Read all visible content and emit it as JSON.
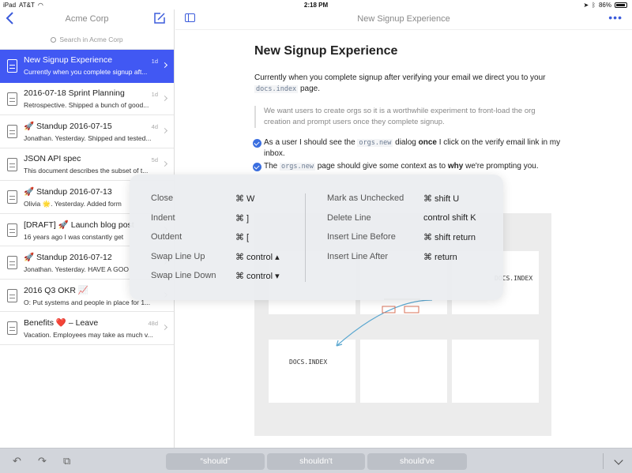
{
  "status": {
    "carrier": "AT&T",
    "ipad": "iPad",
    "time": "2:18 PM",
    "battery": "86%",
    "battery_level": 0.86
  },
  "sidebar": {
    "title": "Acme Corp",
    "search_placeholder": "Search in Acme Corp",
    "items": [
      {
        "title": "New Signup Experience",
        "sub": "Currently when you complete signup aft...",
        "age": "1d",
        "active": true
      },
      {
        "title": "2016-07-18 Sprint Planning",
        "sub": "Retrospective. Shipped a bunch of good...",
        "age": "1d"
      },
      {
        "title": "🚀 Standup 2016-07-15",
        "sub": "Jonathan. Yesterday. Shipped and tested...",
        "age": "4d"
      },
      {
        "title": "JSON API spec",
        "sub": "This document describes the subset of t...",
        "age": "5d"
      },
      {
        "title": "🚀 Standup 2016-07-13",
        "sub": "Olivia 🌟. Yesterday. Added form",
        "age": ""
      },
      {
        "title": "[DRAFT] 🚀 Launch blog post",
        "sub": "16 years ago I was constantly get",
        "age": ""
      },
      {
        "title": "🚀 Standup 2016-07-12",
        "sub": "Jonathan. Yesterday. HAVE A GOO",
        "age": ""
      },
      {
        "title": "2016 Q3 OKR 📈",
        "sub": "O: Put systems and people in place for 1...",
        "age": ""
      },
      {
        "title": "Benefits ❤️ – Leave",
        "sub": "Vacation. Employees may take as much v...",
        "age": "48d"
      }
    ]
  },
  "main": {
    "header_title": "New Signup Experience",
    "doc": {
      "title": "New Signup Experience",
      "p1_a": "Currently when you complete signup after verifying your email we direct you to your",
      "p1_code": "docs.index",
      "p1_b": " page.",
      "quote": "We want users to create orgs so it is a worthwhile experiment to front-load the org creation and prompt users once they complete signup.",
      "todo1_a": "As a user I should see the ",
      "todo1_code": "orgs.new",
      "todo1_b": " dialog ",
      "todo1_bold": "once",
      "todo1_c": " I click on the verify email link in my inbox.",
      "todo2_a": "The ",
      "todo2_code": "orgs.new",
      "todo2_b": " page should give some context as to ",
      "todo2_bold": "why",
      "todo2_c": " we're prompting you."
    },
    "sketch": {
      "label_right": "DOCS.INDEX",
      "label_bottom": "DOCS.INDEX"
    }
  },
  "shortcuts": {
    "left": [
      {
        "action": "Close",
        "keys": "⌘ W"
      },
      {
        "action": "Indent",
        "keys": "⌘ ]"
      },
      {
        "action": "Outdent",
        "keys": "⌘ ["
      },
      {
        "action": "Swap Line Up",
        "keys": "⌘ control ▴"
      },
      {
        "action": "Swap Line Down",
        "keys": "⌘ control ▾"
      }
    ],
    "right": [
      {
        "action": "Mark as Unchecked",
        "keys": "⌘ shift U"
      },
      {
        "action": "Delete Line",
        "keys": "control shift K"
      },
      {
        "action": "Insert Line Before",
        "keys": "⌘ shift return"
      },
      {
        "action": "Insert Line After",
        "keys": "⌘ return"
      }
    ]
  },
  "keyboard": {
    "suggestions": [
      "“should”",
      "shouldn't",
      "should've"
    ]
  }
}
